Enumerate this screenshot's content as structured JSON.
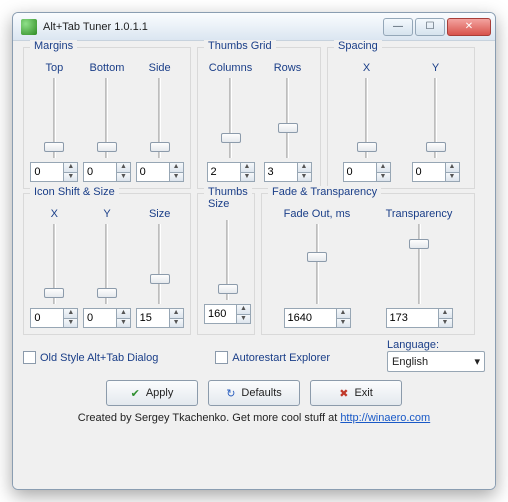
{
  "window": {
    "title": "Alt+Tab Tuner 1.0.1.1"
  },
  "groups": {
    "margins": {
      "legend": "Margins",
      "cols": [
        {
          "label": "Top",
          "value": "0",
          "thumbPct": 92
        },
        {
          "label": "Bottom",
          "value": "0",
          "thumbPct": 92
        },
        {
          "label": "Side",
          "value": "0",
          "thumbPct": 92
        }
      ]
    },
    "thumbsGrid": {
      "legend": "Thumbs Grid",
      "cols": [
        {
          "label": "Columns",
          "value": "2",
          "thumbPct": 78
        },
        {
          "label": "Rows",
          "value": "3",
          "thumbPct": 64
        }
      ]
    },
    "spacing": {
      "legend": "Spacing",
      "cols": [
        {
          "label": "X",
          "value": "0",
          "thumbPct": 92
        },
        {
          "label": "Y",
          "value": "0",
          "thumbPct": 92
        }
      ]
    },
    "iconShift": {
      "legend": "Icon Shift & Size",
      "cols": [
        {
          "label": "X",
          "value": "0",
          "thumbPct": 92
        },
        {
          "label": "Y",
          "value": "0",
          "thumbPct": 92
        },
        {
          "label": "Size",
          "value": "15",
          "thumbPct": 72
        }
      ]
    },
    "thumbsSize": {
      "legend": "Thumbs\nSize",
      "cols": [
        {
          "label": "",
          "value": "160",
          "thumbPct": 92
        }
      ]
    },
    "fade": {
      "legend": "Fade & Transparency",
      "cols": [
        {
          "label": "Fade Out, ms",
          "value": "1640",
          "thumbPct": 40
        },
        {
          "label": "Transparency",
          "value": "173",
          "thumbPct": 22
        }
      ]
    }
  },
  "checks": {
    "oldStyle": "Old Style Alt+Tab Dialog",
    "autorestart": "Autorestart Explorer"
  },
  "language": {
    "label": "Language:",
    "value": "English"
  },
  "buttons": {
    "apply": "Apply",
    "defaults": "Defaults",
    "exit": "Exit"
  },
  "footer": {
    "text": "Created by Sergey Tkachenko. Get more cool stuff at ",
    "link": "http://winaero.com"
  }
}
